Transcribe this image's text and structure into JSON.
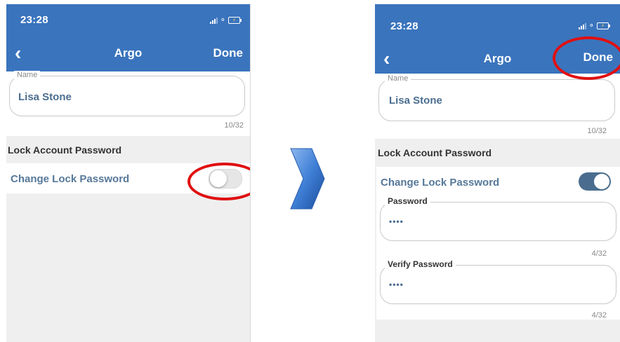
{
  "left_screen": {
    "status": {
      "time": "23:28"
    },
    "header": {
      "title": "Argo",
      "done_label": "Done"
    },
    "name_field": {
      "label": "Name",
      "value": "Lisa Stone",
      "counter": "10/32"
    },
    "section_title": "Lock Account Password",
    "toggle_row": {
      "label": "Change Lock Password",
      "state": "off"
    }
  },
  "right_screen": {
    "status": {
      "time": "23:28"
    },
    "header": {
      "title": "Argo",
      "done_label": "Done"
    },
    "name_field": {
      "label": "Name",
      "value": "Lisa Stone",
      "counter": "10/32"
    },
    "section_title": "Lock Account Password",
    "toggle_row": {
      "label": "Change Lock Password",
      "state": "on"
    },
    "password_field": {
      "label": "Password",
      "value": "••••",
      "counter": "4/32"
    },
    "verify_field": {
      "label": "Verify Password",
      "value": "••••",
      "counter": "4/32"
    }
  },
  "colors": {
    "header_blue": "#3a74bd",
    "label_blue": "#567899",
    "highlight_red": "#e01010",
    "toggle_on": "#4a6d8f"
  },
  "icons": {
    "back": "chevron-left-icon",
    "signal": "signal-bars-icon",
    "wifi": "wifi-icon",
    "battery": "battery-charging-icon",
    "transition": "arrow-right-icon"
  }
}
